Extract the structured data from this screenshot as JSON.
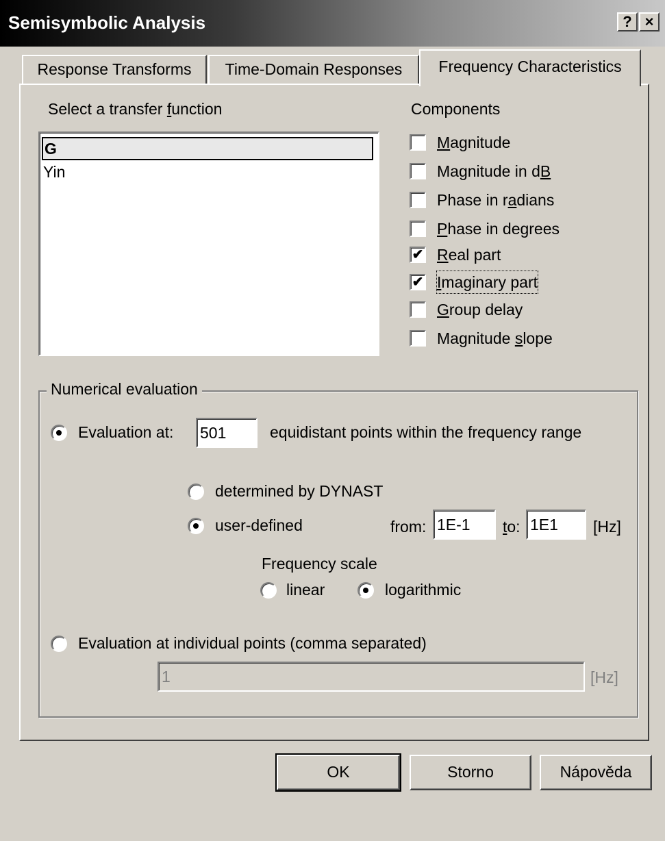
{
  "window": {
    "title": "Semisymbolic Analysis",
    "help_button": "?",
    "close_button": "×"
  },
  "tabs": [
    {
      "label": "Response Transforms",
      "active": false
    },
    {
      "label": "Time-Domain Responses",
      "active": false
    },
    {
      "label": "Frequency Characteristics",
      "active": true
    }
  ],
  "transfer": {
    "heading_pre": "Select a transfer ",
    "heading_u": "f",
    "heading_post": "unction",
    "items": [
      {
        "label": "G",
        "selected": true
      },
      {
        "label": "Yin",
        "selected": false
      }
    ]
  },
  "components": {
    "heading": "Components",
    "items": [
      {
        "pre": "",
        "u": "M",
        "post": "agnitude",
        "checked": false
      },
      {
        "pre": "Magnitude in d",
        "u": "B",
        "post": "",
        "checked": false
      },
      {
        "pre": "Phase in r",
        "u": "a",
        "post": "dians",
        "checked": false
      },
      {
        "pre": "",
        "u": "P",
        "post": "hase in degrees",
        "checked": false
      },
      {
        "pre": "",
        "u": "R",
        "post": "eal part",
        "checked": true
      },
      {
        "pre": "",
        "u": "I",
        "post": "maginary part",
        "checked": true
      },
      {
        "pre": "",
        "u": "G",
        "post": "roup delay",
        "checked": false
      },
      {
        "pre": "Magnitude ",
        "u": "s",
        "post": "lope",
        "checked": false
      }
    ]
  },
  "numerical": {
    "title": "Numerical evaluation",
    "eval_at_label": "Evaluation at:",
    "points_value": "501",
    "points_suffix": "equidistant points within the frequency range",
    "determined_label": "determined by DYNAST",
    "user_defined_label": "user-defined",
    "from_label": "from:",
    "from_value": "1E-1",
    "to_label_u": "t",
    "to_label_post": "o:",
    "to_value": "1E1",
    "unit": "[Hz]",
    "scale_heading": "Frequency scale",
    "linear_label": "linear",
    "log_label": "logarithmic",
    "individual_label": "Evaluation at individual points (comma separated)",
    "individual_value": "1",
    "individual_unit": "[Hz]"
  },
  "buttons": {
    "ok": "OK",
    "cancel": "Storno",
    "help": "Nápověda"
  }
}
